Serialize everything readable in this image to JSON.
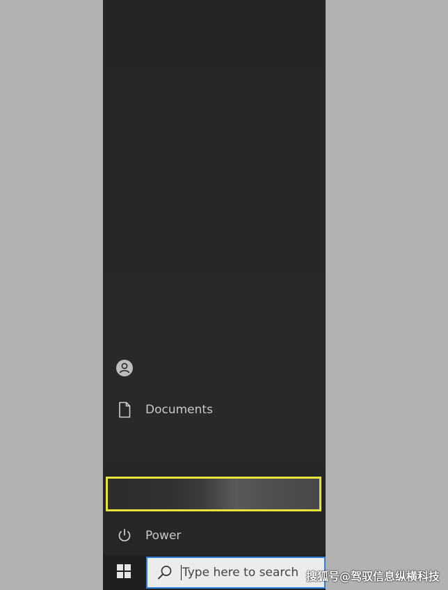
{
  "start_menu": {
    "user_icon": "user-avatar-icon",
    "documents_label": "Documents",
    "documents_icon": "document-icon",
    "power_label": "Power",
    "power_icon": "power-icon",
    "highlight_color": "#e8e33a"
  },
  "taskbar": {
    "start_icon": "windows-logo-icon",
    "search_placeholder": "Type here to search",
    "search_icon": "search-icon",
    "search_border_color": "#2f7fd6"
  },
  "watermark": {
    "text": "搜狐号@驾驭信息纵横科技"
  }
}
